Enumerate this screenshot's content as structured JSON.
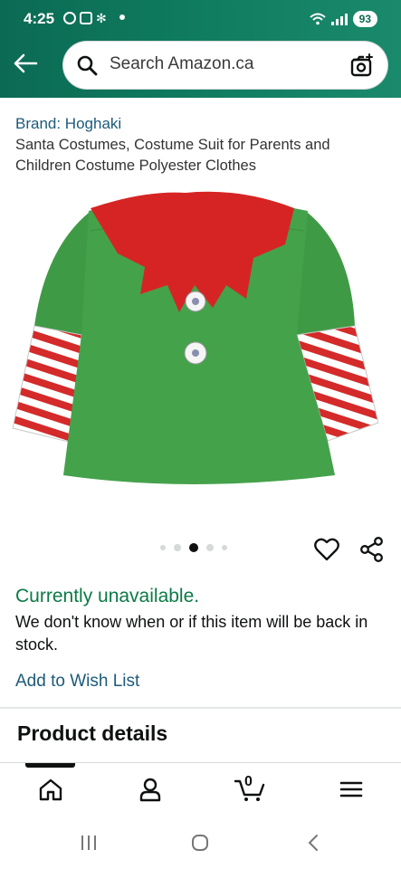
{
  "status_bar": {
    "time": "4:25",
    "battery": "93"
  },
  "search": {
    "placeholder": "Search Amazon.ca"
  },
  "product": {
    "brand": "Brand: Hoghaki",
    "title": "Santa Costumes, Costume Suit for Parents and Children Costume Polyester Clothes"
  },
  "carousel": {
    "total_images": 5,
    "active_index": 3
  },
  "availability": {
    "status": "Currently unavailable.",
    "note": "We don't know when or if this item will be back in stock.",
    "status_color": "#0b7a46"
  },
  "actions": {
    "wishlist_label": "Add to Wish List"
  },
  "section": {
    "heading": "Product details"
  },
  "bottom_nav": {
    "items": [
      "home-icon",
      "account-icon",
      "cart-icon",
      "menu-icon"
    ],
    "cart_count": "0"
  },
  "colors": {
    "header": "#0b6a54",
    "link": "#1c5a7a",
    "accent_text": "#0f1111"
  }
}
